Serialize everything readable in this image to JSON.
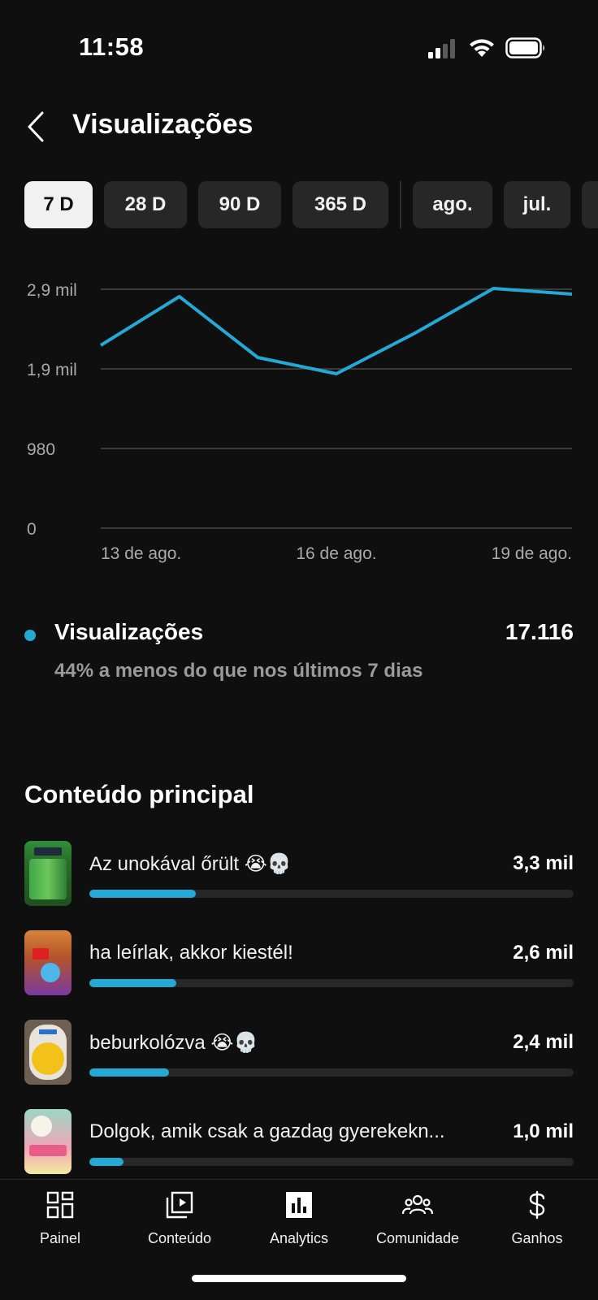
{
  "status_bar": {
    "time": "11:58"
  },
  "header": {
    "title": "Visualizações"
  },
  "chips": [
    {
      "label": "7 D",
      "active": true
    },
    {
      "label": "28 D",
      "active": false
    },
    {
      "label": "90 D",
      "active": false
    },
    {
      "label": "365 D",
      "active": false
    },
    {
      "label": "ago.",
      "active": false
    },
    {
      "label": "jul.",
      "active": false
    }
  ],
  "chart_data": {
    "type": "line",
    "x": [
      "13 de ago.",
      "14 de ago.",
      "15 de ago.",
      "16 de ago.",
      "17 de ago.",
      "18 de ago.",
      "19 de ago."
    ],
    "x_tick_labels": [
      "13 de ago.",
      "16 de ago.",
      "19 de ago."
    ],
    "series": [
      {
        "values": [
          2250,
          2850,
          2100,
          1900,
          2400,
          2950,
          2880
        ],
        "color": "#25a8d4"
      }
    ],
    "y_tick_labels": [
      "2,9 mil",
      "1,9 mil",
      "980",
      "0"
    ],
    "y_ticks": [
      2940,
      1960,
      980,
      0
    ],
    "ylim": [
      0,
      2940
    ],
    "grid": true
  },
  "metric": {
    "label": "Visualizações",
    "value": "17.116",
    "subtitle": "44% a menos do que nos últimos 7 dias",
    "color": "#25a8d4"
  },
  "top_content": {
    "title": "Conteúdo principal",
    "items": [
      {
        "title": "Az unokával őrült 😭💀",
        "value": "3,3 mil",
        "progress": 0.22
      },
      {
        "title": "ha leírlak, akkor kiestél!",
        "value": "2,6 mil",
        "progress": 0.18
      },
      {
        "title": "beburkolózva 😭💀",
        "value": "2,4 mil",
        "progress": 0.165
      },
      {
        "title": "Dolgok, amik csak a gazdag gyerekekn...",
        "value": "1,0 mil",
        "progress": 0.07
      }
    ]
  },
  "bottom_nav": [
    {
      "label": "Painel",
      "icon": "dashboard-icon"
    },
    {
      "label": "Conteúdo",
      "icon": "content-icon"
    },
    {
      "label": "Analytics",
      "icon": "analytics-icon"
    },
    {
      "label": "Comunidade",
      "icon": "community-icon"
    },
    {
      "label": "Ganhos",
      "icon": "earnings-icon"
    }
  ]
}
